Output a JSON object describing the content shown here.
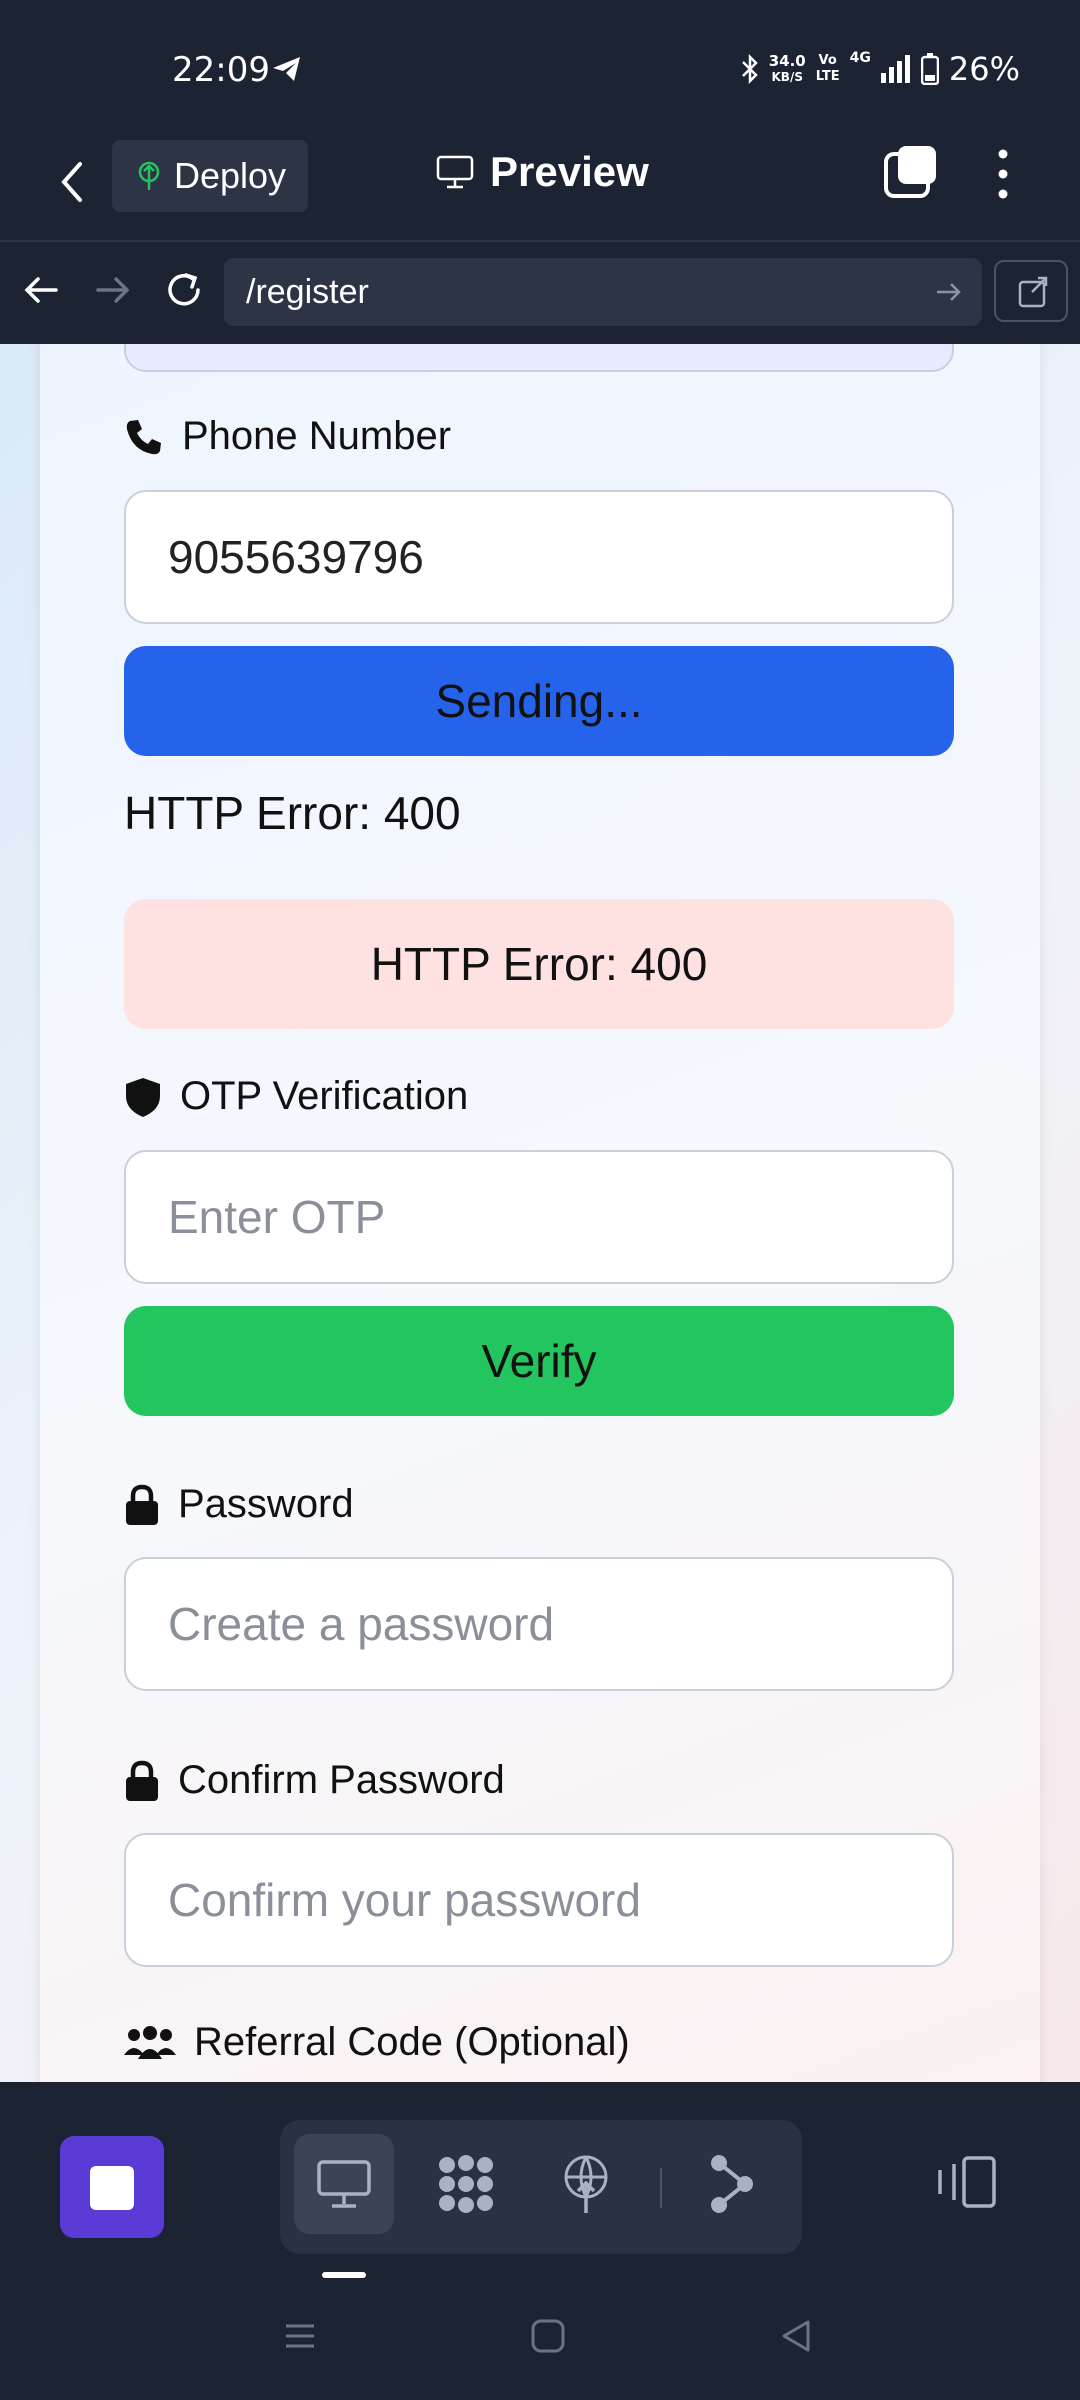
{
  "status_bar": {
    "time": "22:09",
    "net_speed_value": "34.0",
    "net_speed_unit": "KB/S",
    "volte_top": "Vo",
    "volte_bottom": "LTE",
    "network": "4G",
    "battery": "26%"
  },
  "header": {
    "deploy_label": "Deploy",
    "preview_label": "Preview"
  },
  "browser": {
    "url": "/register"
  },
  "form": {
    "phone_label": "Phone Number",
    "phone_value": "9055639796",
    "send_button_label": "Sending...",
    "error_text": "HTTP Error: 400",
    "error_banner": "HTTP Error: 400",
    "otp_label": "OTP Verification",
    "otp_placeholder": "Enter OTP",
    "verify_button_label": "Verify",
    "password_label": "Password",
    "password_placeholder": "Create a password",
    "confirm_label": "Confirm Password",
    "confirm_placeholder": "Confirm your password",
    "referral_label": "Referral Code (Optional)"
  },
  "colors": {
    "app_bg": "#1c2333",
    "send_button": "#2563eb",
    "verify_button": "#22c55e",
    "error_banner_bg": "#fee2e2",
    "stop_button": "#5b3bd6"
  },
  "icons": {
    "phone": "phone-icon",
    "otp": "shield-icon",
    "password": "lock-icon",
    "confirm": "lock-icon",
    "referral": "users-icon"
  }
}
